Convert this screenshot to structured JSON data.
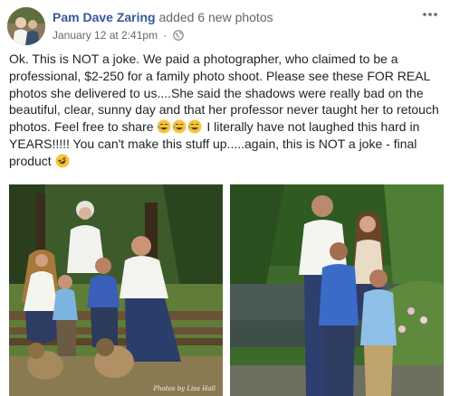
{
  "post": {
    "author": "Pam Dave Zaring",
    "action": "added 6 new photos",
    "timestamp": "January 12 at 2:41pm",
    "dot": "·",
    "more_icon": "more-options-icon",
    "privacy_icon": "globe-icon",
    "text_part1": "Ok. This is NOT a joke. We paid a photographer, who claimed to be a professional, $2-250 for a family photo shoot. Please see these FOR REAL photos she delivered to us....She said the shadows were really bad on the beautiful, clear, sunny day and that her professor never taught her to retouch photos. Feel free to share ",
    "text_part2": " I literally have not laughed this hard in YEARS!!!!! You can't make this stuff up.....again, this is NOT a joke - final product ",
    "emoji_laugh": "grinning-sweat-emoji",
    "emoji_rofl": "rolling-laughing-emoji"
  },
  "photos": {
    "count": 2,
    "watermark": "Photos by Lisa Hall"
  },
  "colors": {
    "author_link": "#365899",
    "text": "#1d2129",
    "meta": "#616770"
  }
}
